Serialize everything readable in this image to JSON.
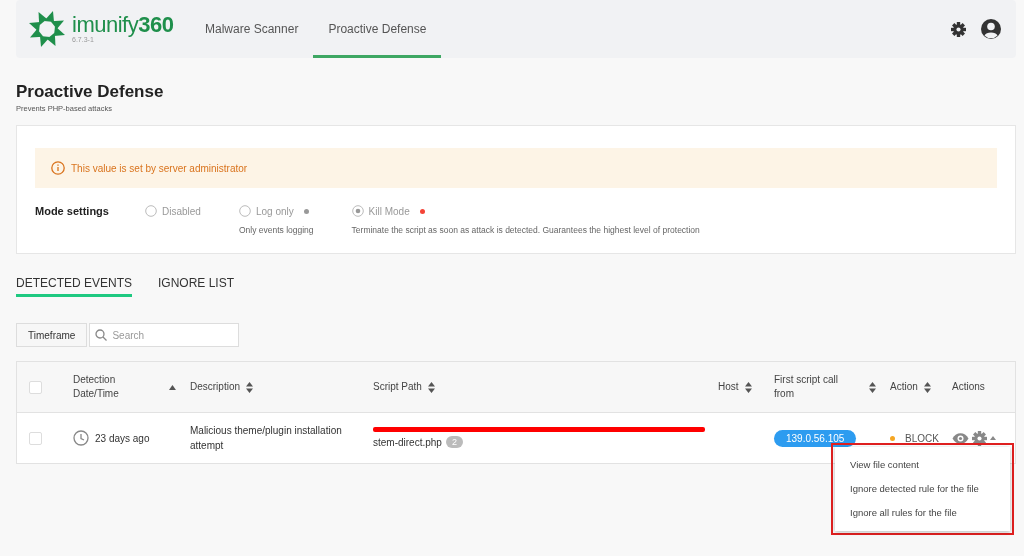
{
  "header": {
    "logo_text": "imunify**360**",
    "version": "6.7.3-1",
    "nav": [
      {
        "label": "Malware Scanner",
        "selected": false
      },
      {
        "label": "Proactive Defense",
        "selected": true
      }
    ]
  },
  "page": {
    "title": "Proactive Defense",
    "subtitle": "Prevents PHP-based attacks"
  },
  "notice": "This value is set by server administrator",
  "mode_settings": {
    "label": "Mode settings",
    "options": [
      {
        "label": "Disabled",
        "selected": false,
        "disabled": true
      },
      {
        "label": "Log only",
        "selected": false,
        "disabled": true,
        "color": "#999999",
        "description": "Only events logging"
      },
      {
        "label": "Kill Mode",
        "selected": true,
        "disabled": true,
        "color": "#f44336",
        "description": "Terminate the script as soon as attack is detected. Guarantees the highest level of protection"
      }
    ]
  },
  "tabs": [
    {
      "label": "DETECTED EVENTS",
      "selected": true
    },
    {
      "label": "IGNORE LIST",
      "selected": false
    }
  ],
  "toolbar": {
    "timeframe_button": "Timeframe",
    "search": {
      "placeholder": "Search"
    }
  },
  "table": {
    "select_all_checked": false,
    "columns": [
      {
        "label": "Detection Date/Time",
        "sortable": true,
        "sorted_ascending": true
      },
      {
        "label": "Description",
        "sortable": true,
        "sorted_ascending": false
      },
      {
        "label": "Script Path",
        "sortable": true,
        "sorted_ascending": false
      },
      {
        "label": "Host",
        "sortable": true,
        "sorted_ascending": false
      },
      {
        "label": "First script call from",
        "sortable": true,
        "sorted_ascending": false
      },
      {
        "label": "Action",
        "sortable": true,
        "sorted_ascending": false
      },
      {
        "label": "Actions",
        "sortable": false
      }
    ],
    "rows": [
      {
        "checked": false,
        "time": "23 days ago",
        "description": "Malicious theme/plugin installation attempt",
        "script_path": "stem-direct.php",
        "path_count": "2",
        "path_redacted": true,
        "first_call": "139.0.56.105",
        "action": "BLOCK",
        "color": "#f5a623",
        "menu_open": true,
        "menu": [
          "View file content",
          "Ignore detected rule for the file",
          "Ignore all rules for the file"
        ]
      }
    ]
  }
}
